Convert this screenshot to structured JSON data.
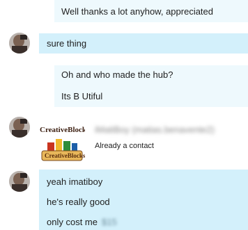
{
  "messages": {
    "m1": "Well thanks a lot anyhow, appreciated",
    "m2": "sure thing",
    "m3a": "Oh and who made the hub?",
    "m3b": "Its B Utiful",
    "m4a": "yeah imatiboy",
    "m4b": "he's really good",
    "m4c": "only cost me",
    "m4c_redacted": "$15"
  },
  "contact": {
    "logo_text_top": "CreativeBlocks",
    "logo_text_bottom": "CreativeBlocks",
    "name": "iMatiBoy (matias.benavente2)",
    "status": "Already a contact"
  },
  "colors": {
    "received_bubble": "#d3f0fb",
    "sent_bubble": "#eef9fd"
  }
}
